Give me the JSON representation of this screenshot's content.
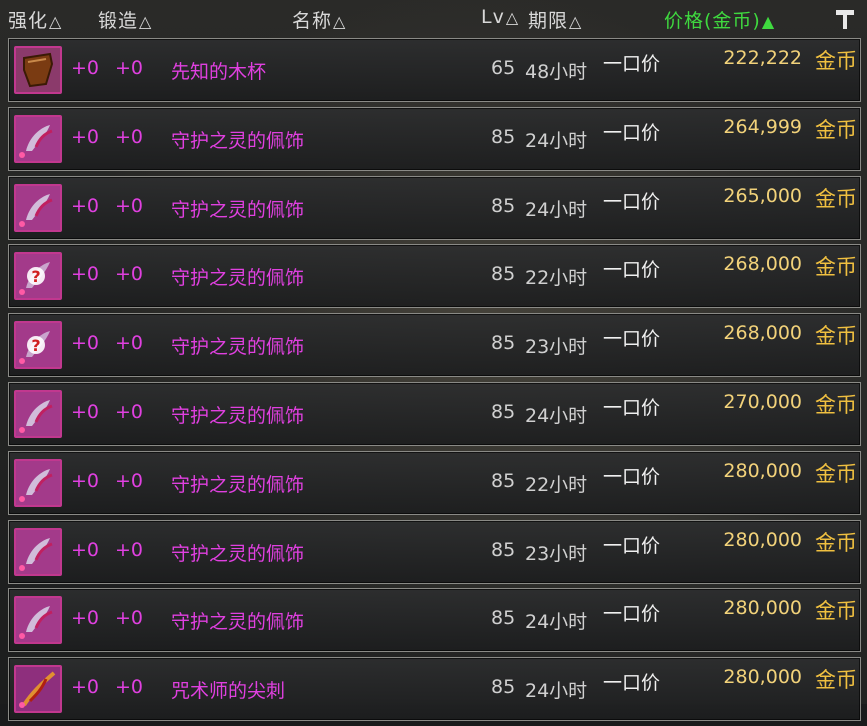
{
  "header": {
    "enhance": "强化",
    "forge": "锻造",
    "name": "名称",
    "lv": "Lv",
    "expire": "期限",
    "price": "价格(金币)"
  },
  "icons": {
    "sort": "triangle-up-icon",
    "active_sort": "filled-triangle-up-icon",
    "tool": "hammer-icon"
  },
  "colors": {
    "item_name": "#e040e0",
    "price": "#f2d27a",
    "active_sort": "#3fd93f",
    "icon_border": "#c1388f"
  },
  "rows": [
    {
      "icon": "wooden-cup-icon",
      "enhance": "+0",
      "forge": "+0",
      "name": "先知的木杯",
      "lv": "65",
      "expire": "48小时",
      "type": "一口价",
      "price": "222,222",
      "currency": "金币"
    },
    {
      "icon": "guardian-ornament-icon",
      "enhance": "+0",
      "forge": "+0",
      "name": "守护之灵的佩饰",
      "lv": "85",
      "expire": "24小时",
      "type": "一口价",
      "price": "264,999",
      "currency": "金币"
    },
    {
      "icon": "guardian-ornament-icon",
      "enhance": "+0",
      "forge": "+0",
      "name": "守护之灵的佩饰",
      "lv": "85",
      "expire": "24小时",
      "type": "一口价",
      "price": "265,000",
      "currency": "金币"
    },
    {
      "icon": "unidentified-ornament-icon",
      "enhance": "+0",
      "forge": "+0",
      "name": "守护之灵的佩饰",
      "lv": "85",
      "expire": "22小时",
      "type": "一口价",
      "price": "268,000",
      "currency": "金币"
    },
    {
      "icon": "unidentified-ornament-icon",
      "enhance": "+0",
      "forge": "+0",
      "name": "守护之灵的佩饰",
      "lv": "85",
      "expire": "23小时",
      "type": "一口价",
      "price": "268,000",
      "currency": "金币"
    },
    {
      "icon": "guardian-ornament-icon",
      "enhance": "+0",
      "forge": "+0",
      "name": "守护之灵的佩饰",
      "lv": "85",
      "expire": "24小时",
      "type": "一口价",
      "price": "270,000",
      "currency": "金币"
    },
    {
      "icon": "guardian-ornament-icon",
      "enhance": "+0",
      "forge": "+0",
      "name": "守护之灵的佩饰",
      "lv": "85",
      "expire": "22小时",
      "type": "一口价",
      "price": "280,000",
      "currency": "金币"
    },
    {
      "icon": "guardian-ornament-icon",
      "enhance": "+0",
      "forge": "+0",
      "name": "守护之灵的佩饰",
      "lv": "85",
      "expire": "23小时",
      "type": "一口价",
      "price": "280,000",
      "currency": "金币"
    },
    {
      "icon": "guardian-ornament-icon",
      "enhance": "+0",
      "forge": "+0",
      "name": "守护之灵的佩饰",
      "lv": "85",
      "expire": "24小时",
      "type": "一口价",
      "price": "280,000",
      "currency": "金币"
    },
    {
      "icon": "sorcerer-spike-icon",
      "enhance": "+0",
      "forge": "+0",
      "name": "咒术师的尖刺",
      "lv": "85",
      "expire": "24小时",
      "type": "一口价",
      "price": "280,000",
      "currency": "金币"
    }
  ]
}
